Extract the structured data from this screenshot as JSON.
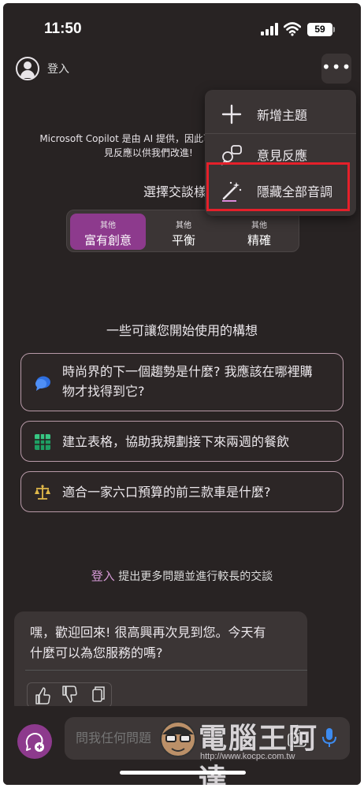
{
  "status_bar": {
    "time": "11:50",
    "battery": "59"
  },
  "header": {
    "signin_label": "登入",
    "more_label": "•••"
  },
  "disclaimer": {
    "line1": "Microsoft Copilot 是由 AI 提供，因此可",
    "line2": "見反應以供我們改進!"
  },
  "conversation_style": {
    "title": "選擇交談樣式",
    "options": [
      {
        "small": "其他",
        "label": "富有創意",
        "active": true
      },
      {
        "small": "其他",
        "label": "平衡",
        "active": false
      },
      {
        "small": "其他",
        "label": "精確",
        "active": false
      }
    ]
  },
  "suggestions": {
    "heading": "一些可讓您開始使用的構想",
    "items": [
      {
        "icon": "speech-bubble-icon",
        "line1": "時尚界的下一個趨勢是什麼? 我應該在哪裡購",
        "line2": "物才找得到它?"
      },
      {
        "icon": "grid-table-icon",
        "line1": "建立表格，協助我規劃接下來兩週的餐飲"
      },
      {
        "icon": "scale-icon",
        "line1": "適合一家六口預算的前三款車是什麼?"
      }
    ]
  },
  "signin_prompt": {
    "link": "登入",
    "text": " 提出更多問題並進行較長的交談"
  },
  "welcome_message": {
    "line1": "嘿，歡迎回來! 很高興再次見到您。今天有",
    "line2": "什麼可以為您服務的嗎?"
  },
  "composer": {
    "placeholder": "問我任何問題"
  },
  "menu": {
    "items": [
      {
        "icon": "plus-icon",
        "label": "新增主題"
      },
      {
        "icon": "feedback-icon",
        "label": "意見反應"
      },
      {
        "icon": "magic-wand-icon",
        "label": "隱藏全部音調"
      }
    ]
  },
  "watermark": {
    "title": "電腦王阿達",
    "url": "http://www.kocpc.com.tw"
  },
  "colors": {
    "accent": "#8d3a8d",
    "background": "#282323",
    "highlight": "#e5202a"
  }
}
